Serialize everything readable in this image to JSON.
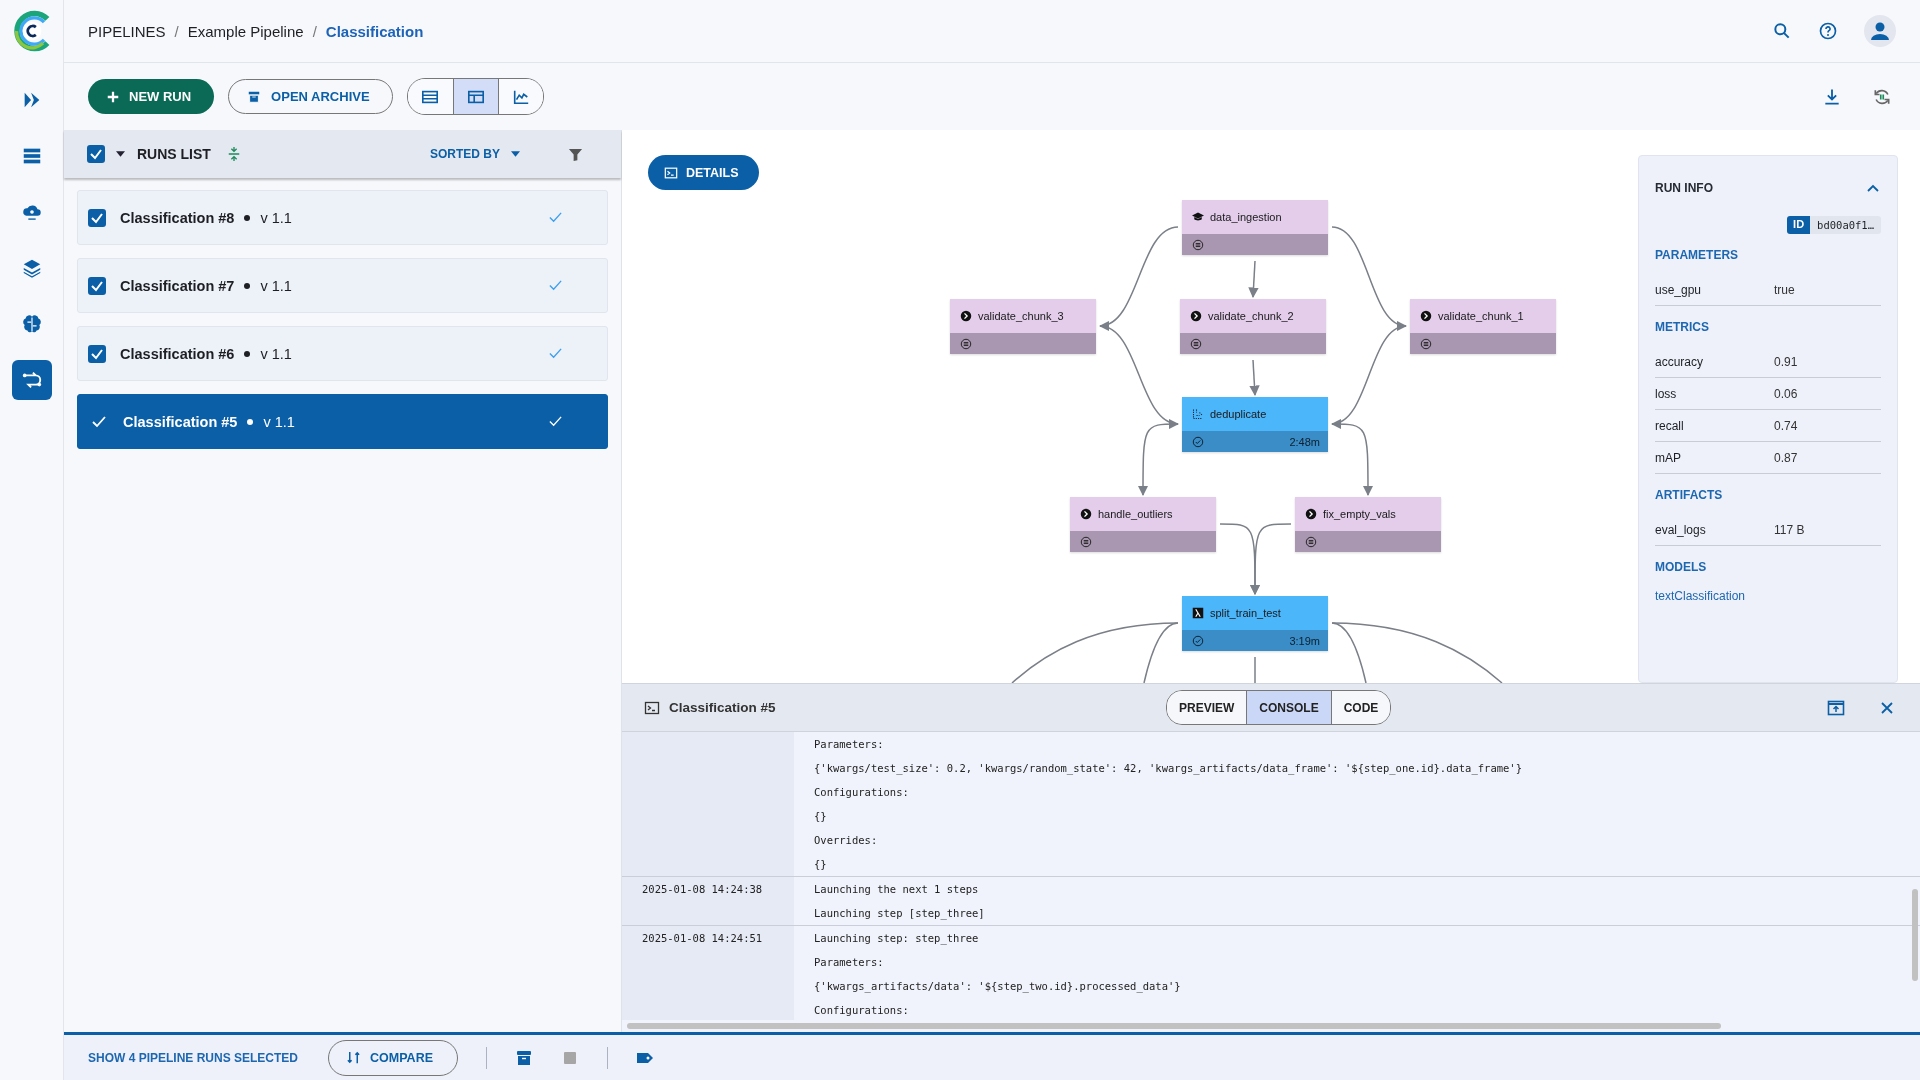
{
  "sidebar": {
    "items": [
      {
        "kind": "chevron",
        "selected": false
      },
      {
        "kind": "server",
        "selected": false
      },
      {
        "kind": "cloud",
        "selected": false
      },
      {
        "kind": "layers",
        "selected": false
      },
      {
        "kind": "brain",
        "selected": false
      },
      {
        "kind": "pipelines",
        "selected": true
      }
    ]
  },
  "breadcrumb": {
    "separator": "/",
    "items": [
      {
        "label": "PIPELINES",
        "current": false
      },
      {
        "label": "Example Pipeline",
        "current": false
      },
      {
        "label": "Classification",
        "current": true
      }
    ]
  },
  "toolbar": {
    "new_run": "NEW RUN",
    "open_archive": "OPEN ARCHIVE",
    "views": [
      {
        "kind": "table",
        "selected": false
      },
      {
        "kind": "details",
        "selected": true
      },
      {
        "kind": "chart",
        "selected": false
      }
    ]
  },
  "runs_list": {
    "title": "RUNS LIST",
    "all_checked": true,
    "sorted_by": "SORTED BY",
    "runs": [
      {
        "name": "Classification #8",
        "version": "v 1.1",
        "checked": true,
        "selected": false,
        "completed": true
      },
      {
        "name": "Classification #7",
        "version": "v 1.1",
        "checked": true,
        "selected": false,
        "completed": true
      },
      {
        "name": "Classification #6",
        "version": "v 1.1",
        "checked": true,
        "selected": false,
        "completed": true
      },
      {
        "name": "Classification #5",
        "version": "v 1.1",
        "checked": true,
        "selected": true,
        "completed": true
      }
    ]
  },
  "details_button": "DETAILS",
  "pipeline": {
    "nodes": [
      {
        "label": "data_ingestion",
        "kind": "ingest",
        "completed": false
      },
      {
        "label": "validate_chunk_3",
        "kind": "step",
        "completed": false
      },
      {
        "label": "validate_chunk_2",
        "kind": "step",
        "completed": false
      },
      {
        "label": "validate_chunk_1",
        "kind": "step",
        "completed": false
      },
      {
        "label": "deduplicate",
        "kind": "dedupe",
        "completed": true,
        "duration": "2:48m"
      },
      {
        "label": "handle_outliers",
        "kind": "step",
        "completed": false
      },
      {
        "label": "fix_empty_vals",
        "kind": "step",
        "completed": false
      },
      {
        "label": "split_train_test",
        "kind": "lambda",
        "completed": true,
        "duration": "3:19m"
      }
    ]
  },
  "run_info": {
    "title": "RUN INFO",
    "expanded": true,
    "id_label": "ID",
    "id": "bd00a0f1…",
    "sections": [
      {
        "title": "PARAMETERS",
        "rows": [
          {
            "name": "use_gpu",
            "value": "true"
          }
        ]
      },
      {
        "title": "METRICS",
        "rows": [
          {
            "name": "accuracy",
            "value": "0.91"
          },
          {
            "name": "loss",
            "value": "0.06"
          },
          {
            "name": "recall",
            "value": "0.74"
          },
          {
            "name": "mAP",
            "value": "0.87"
          }
        ]
      },
      {
        "title": "ARTIFACTS",
        "rows": [
          {
            "name": "eval_logs",
            "value": "117 B"
          }
        ]
      },
      {
        "title": "MODELS",
        "links": [
          "textClassification"
        ]
      }
    ]
  },
  "console": {
    "title": "Classification #5",
    "tabs": [
      {
        "label": "PREVIEW",
        "selected": false
      },
      {
        "label": "CONSOLE",
        "selected": true
      },
      {
        "label": "CODE",
        "selected": false
      }
    ],
    "entries": [
      {
        "lines": [
          "Parameters:",
          "{'kwargs/test_size': 0.2, 'kwargs/random_state': 42, 'kwargs_artifacts/data_frame': '${step_one.id}.data_frame'}",
          "Configurations:",
          "{}",
          "Overrides:",
          "{}"
        ]
      },
      {
        "timestamp": "2025-01-08 14:24:38",
        "lines": [
          "Launching the next 1 steps",
          "Launching step [step_three]"
        ]
      },
      {
        "timestamp": "2025-01-08 14:24:51",
        "lines": [
          "Launching step: step_three",
          "Parameters:",
          "{'kwargs_artifacts/data': '${step_two.id}.processed_data'}",
          "Configurations:"
        ]
      }
    ]
  },
  "bottom_bar": {
    "selection_text": "SHOW 4 PIPELINE RUNS SELECTED",
    "compare": "COMPARE",
    "actions": [
      {
        "kind": "archive",
        "disabled": false
      },
      {
        "kind": "stop",
        "disabled": true
      },
      {
        "kind": "tag",
        "disabled": false
      }
    ]
  }
}
